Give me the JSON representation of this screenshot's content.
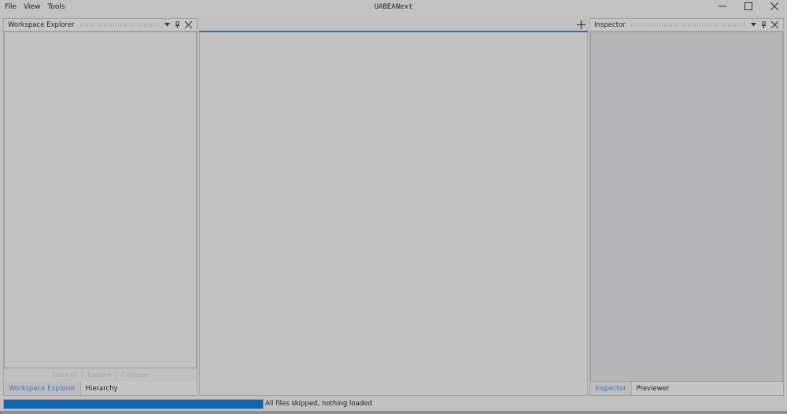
{
  "window": {
    "title": "UABEANext",
    "menu": [
      "File",
      "View",
      "Tools"
    ],
    "controls": [
      "minimize-icon",
      "maximize-icon",
      "close-icon"
    ]
  },
  "left_panel": {
    "title": "Workspace Explorer",
    "header_icons": [
      "dropdown-arrow-icon",
      "pin-icon",
      "close-icon"
    ],
    "actions": [
      "Load all",
      "Expand",
      "Collapse"
    ],
    "tabs": [
      {
        "label": "Workspace Explorer",
        "active": true
      },
      {
        "label": "Hierarchy",
        "active": false
      }
    ]
  },
  "document_area": {
    "add_tab_icon": "plus-icon"
  },
  "right_panel": {
    "title": "Inspector",
    "header_icons": [
      "dropdown-arrow-icon",
      "pin-icon",
      "close-icon"
    ],
    "tabs": [
      {
        "label": "Inspector",
        "active": true
      },
      {
        "label": "Previewer",
        "active": false
      }
    ]
  },
  "status": {
    "progress": 1.0,
    "message": "All files skipped, nothing loaded"
  },
  "colors": {
    "accent": "#0e65b4",
    "active_tab_text": "#3a7bd0",
    "background": "#c1c1c1"
  }
}
